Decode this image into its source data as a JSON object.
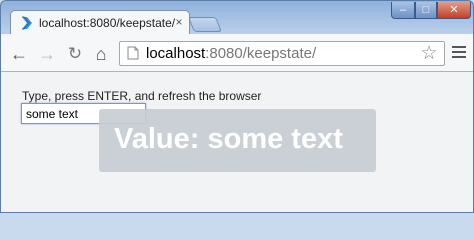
{
  "tab": {
    "title": "localhost:8080/keepstate/",
    "close_glyph": "×",
    "favicon": "angle-brackets-icon"
  },
  "window_controls": {
    "minimize": "–",
    "maximize": "□",
    "close": "✕"
  },
  "toolbar": {
    "back_glyph": "←",
    "forward_glyph": "→",
    "reload_glyph": "↻",
    "home_glyph": "⌂",
    "url_host": "localhost",
    "url_rest": ":8080/keepstate/",
    "star_glyph": "☆"
  },
  "page": {
    "instruction": "Type, press ENTER, and refresh the browser",
    "input_value": "some text",
    "value_display": "Value: some text"
  },
  "colors": {
    "favicon": "#3a8fd9",
    "overlay": "#c8cdd4",
    "input_border": "#6d9ad6"
  }
}
